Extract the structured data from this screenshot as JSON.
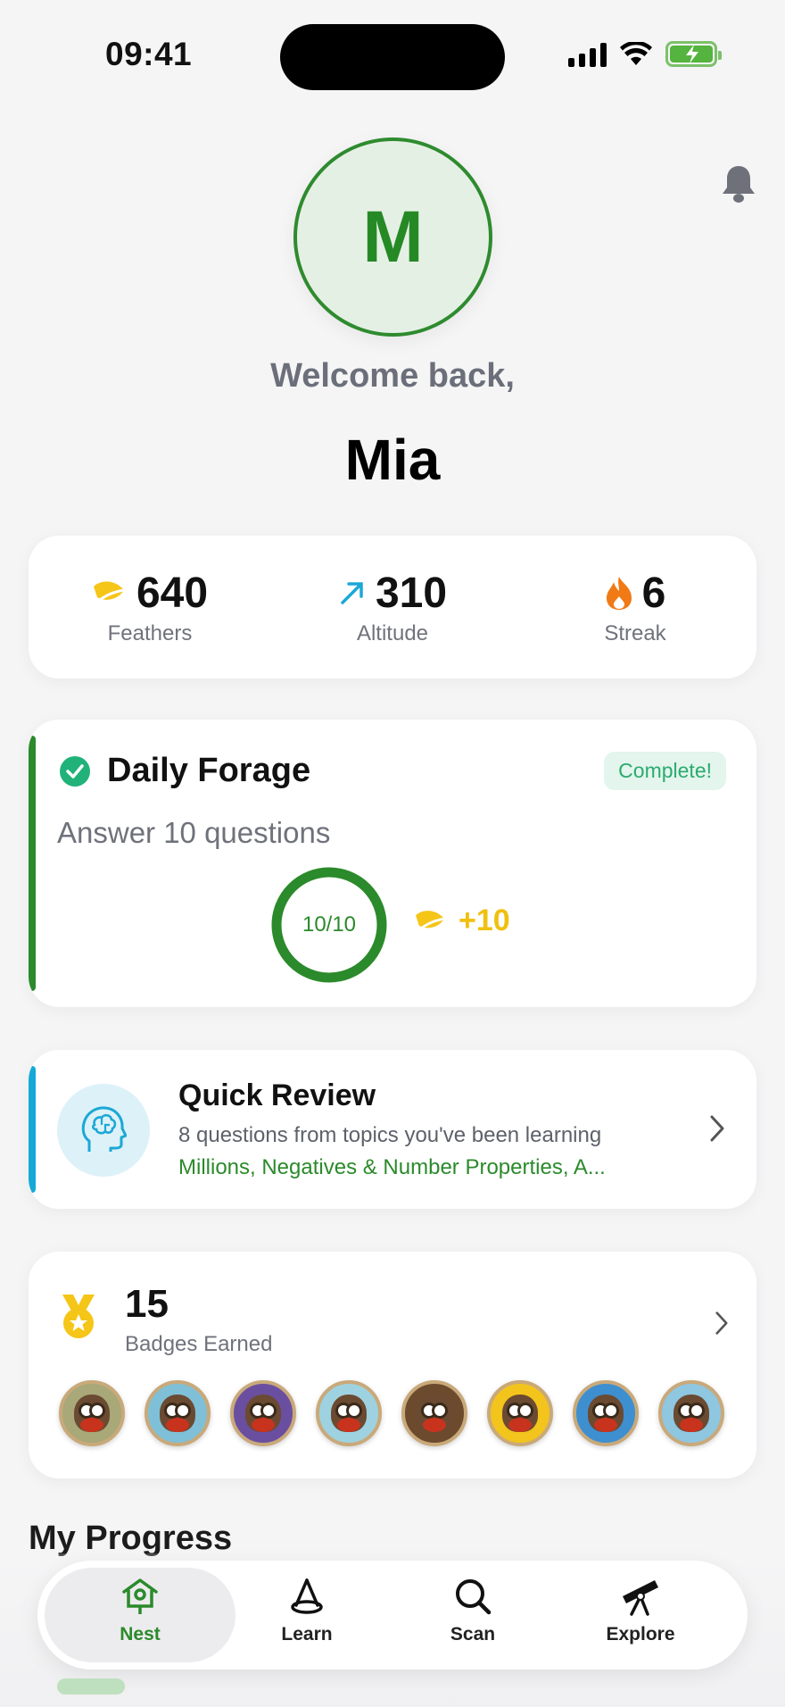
{
  "status_bar": {
    "time": "09:41"
  },
  "header": {
    "avatar_initial": "M",
    "welcome": "Welcome back,",
    "username": "Mia"
  },
  "stats": [
    {
      "icon": "feather-icon",
      "value": "640",
      "label": "Feathers",
      "color": "#F5C518"
    },
    {
      "icon": "arrow-up-right-icon",
      "value": "310",
      "label": "Altitude",
      "color": "#1BA8D6"
    },
    {
      "icon": "flame-icon",
      "value": "6",
      "label": "Streak",
      "color": "#F07A16"
    }
  ],
  "daily_forage": {
    "title": "Daily Forage",
    "status": "Complete!",
    "subtitle": "Answer 10 questions",
    "progress_text": "10/10",
    "progress_fraction": 1.0,
    "reward": "+10",
    "accent_color": "#2B8A2B"
  },
  "quick_review": {
    "title": "Quick Review",
    "subtitle": "8 questions from topics you've been learning",
    "topics": "Millions, Negatives & Number Properties, A...",
    "accent_color": "#14A9D6"
  },
  "badges": {
    "count": "15",
    "label": "Badges Earned",
    "coins": [
      {
        "name": "badge-1",
        "bg": "#a8a878"
      },
      {
        "name": "badge-2",
        "bg": "#7fc0d8"
      },
      {
        "name": "badge-3",
        "bg": "#6a4fa0"
      },
      {
        "name": "badge-4",
        "bg": "#9fd2e0"
      },
      {
        "name": "badge-5",
        "bg": "#6b4a2e"
      },
      {
        "name": "badge-6",
        "bg": "#f2c41c"
      },
      {
        "name": "badge-7",
        "bg": "#3e8fd0"
      },
      {
        "name": "badge-8",
        "bg": "#8fc6e0"
      }
    ]
  },
  "section_title": "My Progress",
  "tabbar": {
    "active": "Nest",
    "tabs": [
      {
        "label": "Nest",
        "icon": "birdhouse-icon"
      },
      {
        "label": "Learn",
        "icon": "cone-icon"
      },
      {
        "label": "Scan",
        "icon": "magnifier-icon"
      },
      {
        "label": "Explore",
        "icon": "telescope-icon"
      }
    ]
  }
}
